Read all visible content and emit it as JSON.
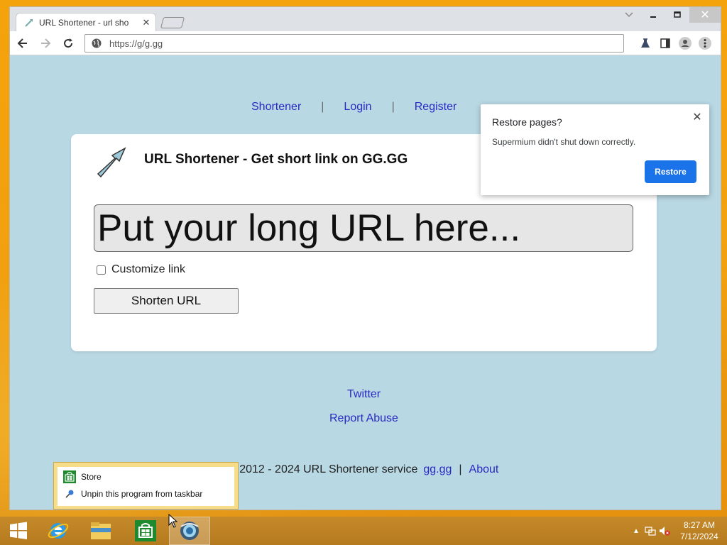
{
  "browser": {
    "tab_title": "URL Shortener - url sho",
    "url": "https://g/g.gg"
  },
  "page": {
    "nav": {
      "shortener": "Shortener",
      "login": "Login",
      "register": "Register",
      "separator": "|"
    },
    "card_title": "URL Shortener - Get short link on GG.GG",
    "url_input_placeholder": "Put your long URL here...",
    "customize_label": "Customize link",
    "shorten_button": "Shorten URL",
    "footer": {
      "twitter": "Twitter",
      "report_abuse": "Report Abuse",
      "copyright": "© 2012 - 2024 URL Shortener service",
      "domain_link": "gg.gg",
      "pipe": "|",
      "about": "About"
    }
  },
  "restore_popup": {
    "title": "Restore pages?",
    "message": "Supermium didn't shut down correctly.",
    "restore_button": "Restore"
  },
  "jumplist": {
    "items": [
      {
        "label": "Store",
        "icon": "store-icon"
      },
      {
        "label": "Unpin this program from taskbar",
        "icon": "unpin-icon"
      }
    ]
  },
  "taskbar": {
    "time": "8:27 AM",
    "date": "7/12/2024"
  },
  "colors": {
    "page_bg": "#b8d8e4",
    "link": "#2a2ac0",
    "restore_button": "#1a73e8",
    "desktop": "#f0a010"
  }
}
